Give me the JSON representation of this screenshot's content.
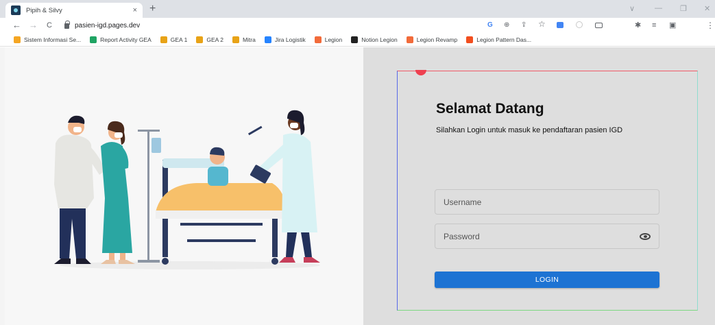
{
  "browser": {
    "tab_title": "Pipih & Silvy",
    "tab_close": "×",
    "new_tab": "+",
    "url": "pasien-igd.pages.dev",
    "nav": {
      "back": "←",
      "forward": "→",
      "reload": "C"
    },
    "window_controls": {
      "collapse": "∨",
      "minimize": "—",
      "restore": "❐",
      "close": "✕"
    },
    "extensions": {
      "google": "G",
      "install": "⊕",
      "share": "⇪",
      "star": "☆",
      "puzzle": "✱",
      "reading": "≡",
      "sidepanel": "▣",
      "menu": "⋮"
    }
  },
  "bookmarks": [
    {
      "label": "Sistem Informasi Se...",
      "color": "#f5a623"
    },
    {
      "label": "Report Activity GEA",
      "color": "#1fa463"
    },
    {
      "label": "GEA 1",
      "color": "#e8a317"
    },
    {
      "label": "GEA 2",
      "color": "#e8a317"
    },
    {
      "label": "Mitra",
      "color": "#e8a317"
    },
    {
      "label": "Jira Logistik",
      "color": "#2684ff"
    },
    {
      "label": "Legion",
      "color": "#f26b3a"
    },
    {
      "label": "Notion Legion",
      "color": "#222222"
    },
    {
      "label": "Legion Revamp",
      "color": "#f26b3a"
    },
    {
      "label": "Legion Pattern Das...",
      "color": "#f24e1e"
    }
  ],
  "login": {
    "title": "Selamat Datang",
    "subtitle": "Silahkan Login untuk masuk ke pendaftaran pasien IGD",
    "username_placeholder": "Username",
    "password_placeholder": "Password",
    "button_label": "LOGIN"
  },
  "colors": {
    "accent": "#1d73d3",
    "panel_bg": "#dedede",
    "card_top": "#ef5a68",
    "card_left": "#5667e8",
    "card_right": "#8edcd0",
    "card_bottom": "#7dd782"
  }
}
